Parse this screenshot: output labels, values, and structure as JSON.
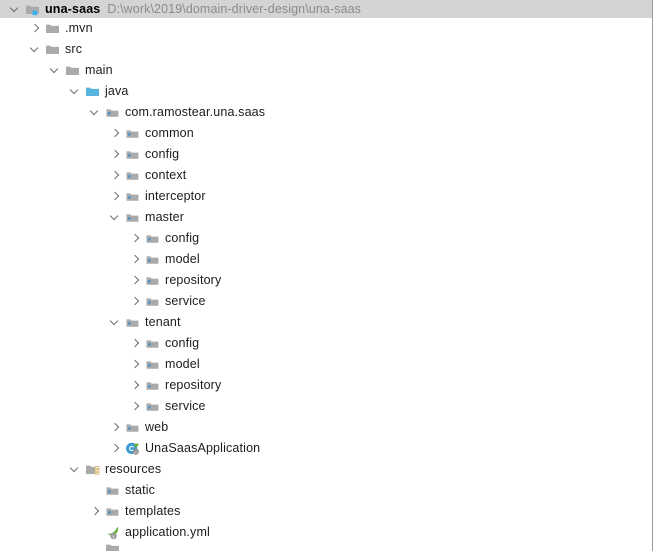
{
  "panel": {
    "name": "project-tool-window"
  },
  "header": {
    "project_name": "una-saas",
    "project_path": "D:\\work\\2019\\domain-driver-design\\una-saas",
    "icon": "module-folder-icon",
    "arrow": "expanded"
  },
  "colors": {
    "header_background": "#d4d4d4",
    "panel_background": "#ffffff",
    "text": "#1c1c1c",
    "path_text": "#8c8c8c",
    "folder_grey": "#a8aaac",
    "source_folder_cyan": "#56b6e0",
    "package_blue": "#4a90c4",
    "resource_yellow": "#d8a13a",
    "spring_green": "#6db33f",
    "class_teal": "#3c9bd0",
    "arrow_grey": "#6e6e6e",
    "panel_border": "#9a9a9a"
  },
  "tree": [
    {
      "label": ".mvn",
      "depth": 1,
      "arrow": "collapsed",
      "icon": "folder-icon"
    },
    {
      "label": "src",
      "depth": 1,
      "arrow": "expanded",
      "icon": "folder-icon"
    },
    {
      "label": "main",
      "depth": 2,
      "arrow": "expanded",
      "icon": "folder-icon"
    },
    {
      "label": "java",
      "depth": 3,
      "arrow": "expanded",
      "icon": "source-folder-icon"
    },
    {
      "label": "com.ramostear.una.saas",
      "depth": 4,
      "arrow": "expanded",
      "icon": "package-icon"
    },
    {
      "label": "common",
      "depth": 5,
      "arrow": "collapsed",
      "icon": "package-icon"
    },
    {
      "label": "config",
      "depth": 5,
      "arrow": "collapsed",
      "icon": "package-icon"
    },
    {
      "label": "context",
      "depth": 5,
      "arrow": "collapsed",
      "icon": "package-icon"
    },
    {
      "label": "interceptor",
      "depth": 5,
      "arrow": "collapsed",
      "icon": "package-icon"
    },
    {
      "label": "master",
      "depth": 5,
      "arrow": "expanded",
      "icon": "package-icon"
    },
    {
      "label": "config",
      "depth": 6,
      "arrow": "collapsed",
      "icon": "package-icon"
    },
    {
      "label": "model",
      "depth": 6,
      "arrow": "collapsed",
      "icon": "package-icon"
    },
    {
      "label": "repository",
      "depth": 6,
      "arrow": "collapsed",
      "icon": "package-icon"
    },
    {
      "label": "service",
      "depth": 6,
      "arrow": "collapsed",
      "icon": "package-icon"
    },
    {
      "label": "tenant",
      "depth": 5,
      "arrow": "expanded",
      "icon": "package-icon"
    },
    {
      "label": "config",
      "depth": 6,
      "arrow": "collapsed",
      "icon": "package-icon"
    },
    {
      "label": "model",
      "depth": 6,
      "arrow": "collapsed",
      "icon": "package-icon"
    },
    {
      "label": "repository",
      "depth": 6,
      "arrow": "collapsed",
      "icon": "package-icon"
    },
    {
      "label": "service",
      "depth": 6,
      "arrow": "collapsed",
      "icon": "package-icon"
    },
    {
      "label": "web",
      "depth": 5,
      "arrow": "collapsed",
      "icon": "package-icon"
    },
    {
      "label": "UnaSaasApplication",
      "depth": 5,
      "arrow": "collapsed",
      "icon": "spring-class-icon"
    },
    {
      "label": "resources",
      "depth": 3,
      "arrow": "expanded",
      "icon": "resource-folder-icon"
    },
    {
      "label": "static",
      "depth": 4,
      "arrow": "none",
      "icon": "package-icon"
    },
    {
      "label": "templates",
      "depth": 4,
      "arrow": "collapsed",
      "icon": "package-icon"
    },
    {
      "label": "application.yml",
      "depth": 4,
      "arrow": "none",
      "icon": "spring-yml-icon"
    },
    {
      "label": "",
      "depth": 4,
      "arrow": "none",
      "icon": "folder-icon",
      "clipped": true
    }
  ]
}
